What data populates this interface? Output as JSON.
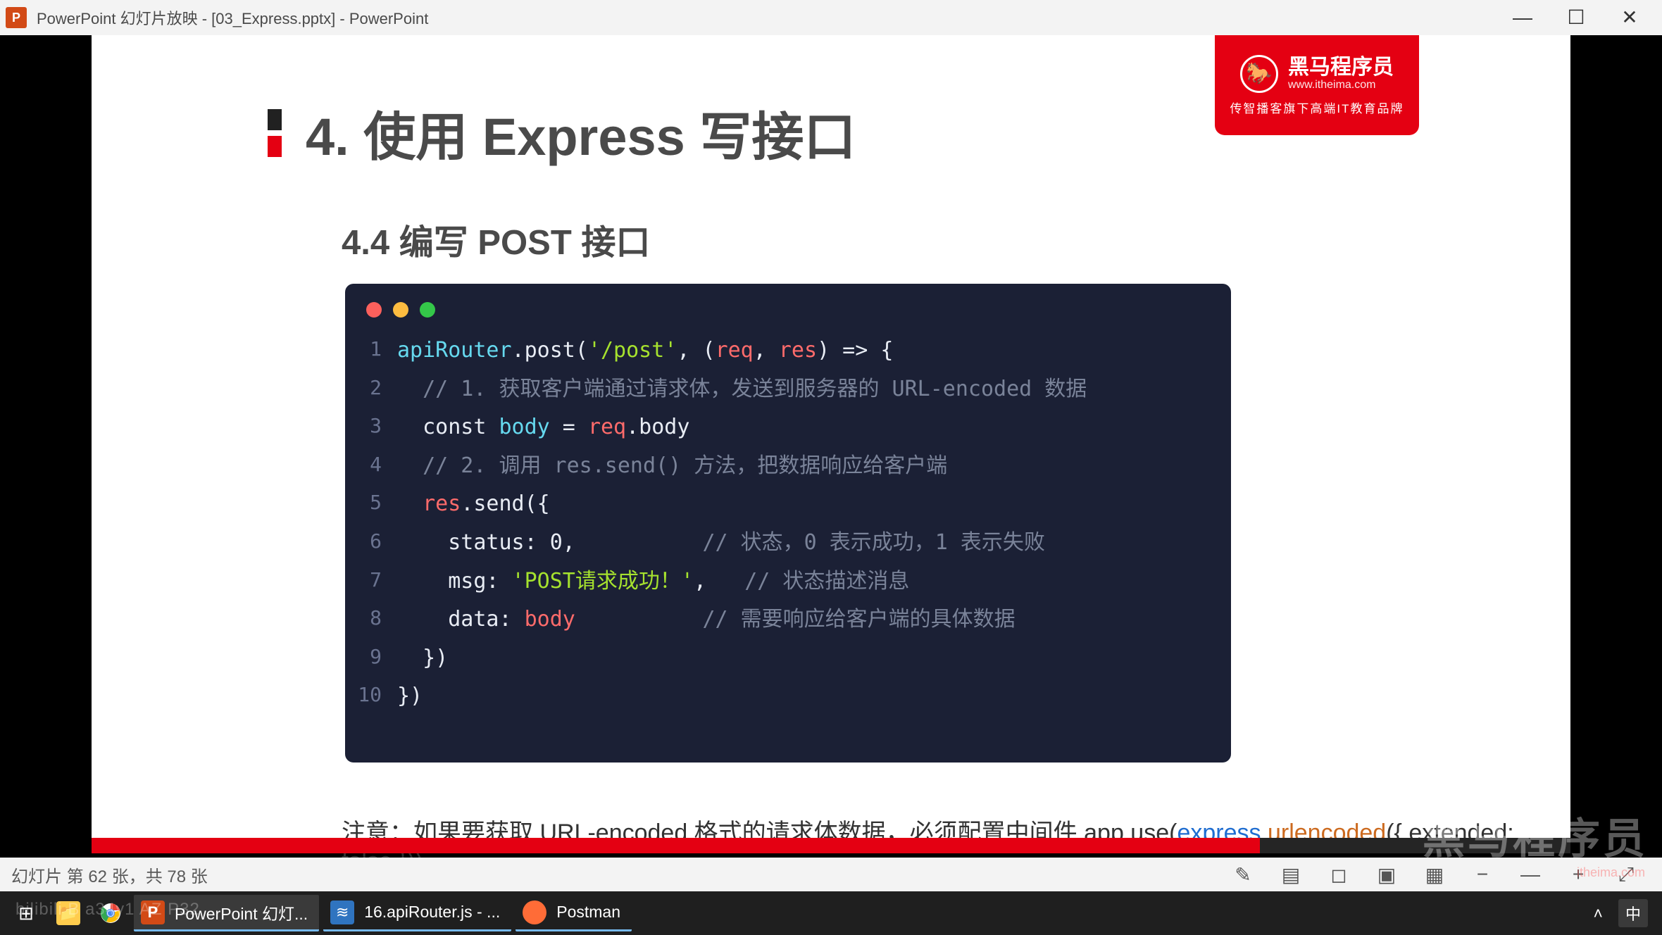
{
  "window": {
    "title": "PowerPoint 幻灯片放映 - [03_Express.pptx] - PowerPoint",
    "app_icon_letter": "P"
  },
  "slide": {
    "title": "4. 使用 Express 写接口",
    "subtitle": "4.4 编写 POST 接口",
    "logo": {
      "name": "黑马程序员",
      "url": "www.itheima.com",
      "tagline": "传智播客旗下高端IT教育品牌"
    },
    "code": {
      "lines": [
        {
          "n": "1",
          "html": "<span class='tok-teal'>apiRouter</span><span class='tok-plain'>.post(</span><span class='tok-green'>'/post'</span><span class='tok-plain'>, (</span><span class='tok-red'>req</span><span class='tok-plain'>, </span><span class='tok-red'>res</span><span class='tok-plain'>) =&gt; {</span>"
        },
        {
          "n": "2",
          "html": "  <span class='tok-comment'>// 1. 获取客户端通过请求体，发送到服务器的 URL-encoded 数据</span>"
        },
        {
          "n": "3",
          "html": "  <span class='tok-plain'>const </span><span class='tok-teal'>body</span><span class='tok-plain'> = </span><span class='tok-red'>req</span><span class='tok-plain'>.body</span>"
        },
        {
          "n": "4",
          "html": "  <span class='tok-comment'>// 2. 调用 res.send() 方法，把数据响应给客户端</span>"
        },
        {
          "n": "5",
          "html": "  <span class='tok-red'>res</span><span class='tok-plain'>.send({</span>"
        },
        {
          "n": "6",
          "html": "    <span class='tok-plain'>status: 0,</span>          <span class='tok-comment'>// 状态，0 表示成功，1 表示失败</span>"
        },
        {
          "n": "7",
          "html": "    <span class='tok-plain'>msg: </span><span class='tok-green'>'POST请求成功！'</span><span class='tok-plain'>,</span>   <span class='tok-comment'>// 状态描述消息</span>"
        },
        {
          "n": "8",
          "html": "    <span class='tok-plain'>data: </span><span class='tok-red'>body</span>          <span class='tok-comment'>// 需要响应给客户端的具体数据</span>"
        },
        {
          "n": "9",
          "html": "  <span class='tok-plain'>})</span>"
        },
        {
          "n": "10",
          "html": "<span class='tok-plain'>})</span>"
        }
      ]
    },
    "note": {
      "prefix": "注意：如果要获取 URL-encoded 格式的请求体数据，必须配置中间件 app.use(",
      "express": "express",
      "dot": ".",
      "urlencoded": "urlencoded",
      "suffix": "({ extended: false }))"
    }
  },
  "progress": {
    "percent": 79
  },
  "status": {
    "text": "幻灯片 第 62 张，共 78 张"
  },
  "taskbar": {
    "items": [
      {
        "id": "start",
        "label": "",
        "color": "#fff"
      },
      {
        "id": "explorer",
        "label": "",
        "color": "#ffcc4d"
      },
      {
        "id": "chrome",
        "label": "",
        "color": ""
      },
      {
        "id": "powerpoint",
        "label": "PowerPoint 幻灯...",
        "color": "#d24a16"
      },
      {
        "id": "vscode",
        "label": "16.apiRouter.js - ...",
        "color": "#2f74c0"
      },
      {
        "id": "postman",
        "label": "Postman",
        "color": "#ff6c37"
      }
    ],
    "ime": "中"
  },
  "overlay": {
    "bili": "bilibili  B  a34y1  AZ  P32",
    "watermark": "黑马程序员",
    "watermark_sub": "itheima.com"
  }
}
